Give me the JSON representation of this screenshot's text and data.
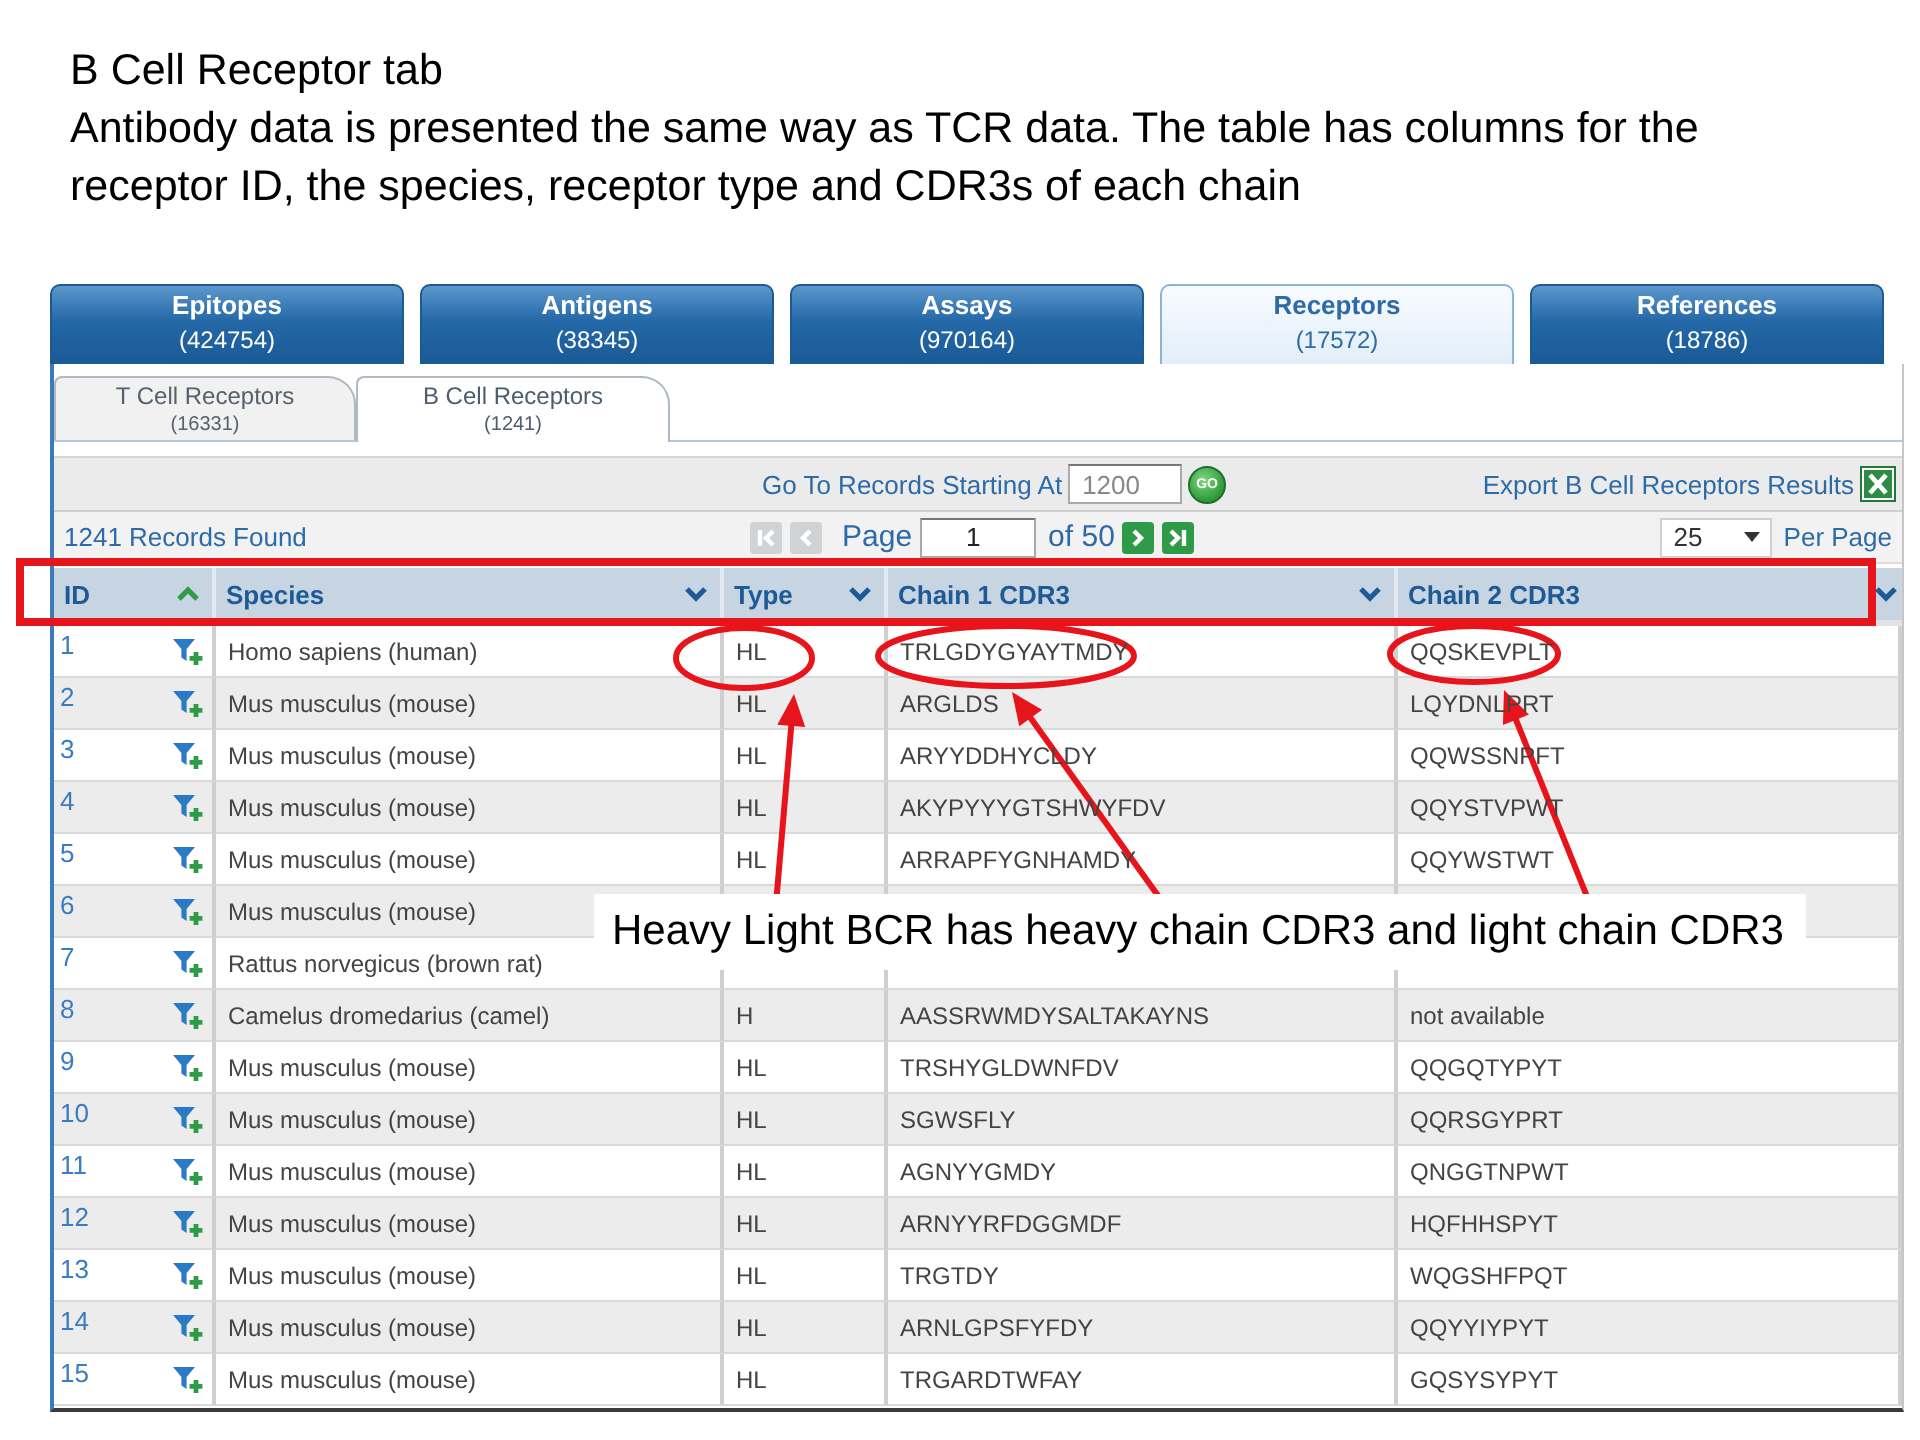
{
  "slide": {
    "title": "B Cell Receptor tab",
    "description": "Antibody data is presented the same way as TCR data. The table has columns for the receptor ID, the species, receptor type and CDR3s of each chain"
  },
  "main_tabs": [
    {
      "label": "Epitopes",
      "count": "(424754)",
      "selected": false
    },
    {
      "label": "Antigens",
      "count": "(38345)",
      "selected": false
    },
    {
      "label": "Assays",
      "count": "(970164)",
      "selected": false
    },
    {
      "label": "Receptors",
      "count": "(17572)",
      "selected": true
    },
    {
      "label": "References",
      "count": "(18786)",
      "selected": false
    }
  ],
  "sub_tabs": [
    {
      "label": "T Cell Receptors",
      "count": "(16331)",
      "selected": false
    },
    {
      "label": "B Cell Receptors",
      "count": "(1241)",
      "selected": true
    }
  ],
  "goto": {
    "label": "Go To Records Starting At",
    "value": "1200",
    "button": "GO"
  },
  "export": {
    "label": "Export B Cell Receptors Results"
  },
  "pager": {
    "records_found": "1241 Records Found",
    "back_buttons": [
      {
        "kind": "first",
        "disabled": true
      },
      {
        "kind": "previous",
        "disabled": true
      }
    ],
    "page_label": "Page",
    "page_value": "1",
    "page_total": "of 50",
    "forward_buttons": [
      {
        "kind": "next",
        "disabled": false
      },
      {
        "kind": "last",
        "disabled": false
      }
    ],
    "page_size": "25",
    "per_page_label": "Per Page"
  },
  "table": {
    "columns": [
      {
        "label": "ID",
        "sorted": true
      },
      {
        "label": "Species",
        "sorted": false
      },
      {
        "label": "Type",
        "sorted": false
      },
      {
        "label": "Chain 1 CDR3",
        "sorted": false
      },
      {
        "label": "Chain 2 CDR3",
        "sorted": false
      }
    ],
    "rows": [
      {
        "id": "1",
        "species": "Homo sapiens (human)",
        "type": "HL",
        "chain_1_cdr3": "TRLGDYGYAYTMDY",
        "chain_2_cdr3": "QQSKEVPLT"
      },
      {
        "id": "2",
        "species": "Mus musculus (mouse)",
        "type": "HL",
        "chain_1_cdr3": "ARGLDS",
        "chain_2_cdr3": "LQYDNLPRT"
      },
      {
        "id": "3",
        "species": "Mus musculus (mouse)",
        "type": "HL",
        "chain_1_cdr3": "ARYYDDHYCLDY",
        "chain_2_cdr3": "QQWSSNPFT"
      },
      {
        "id": "4",
        "species": "Mus musculus (mouse)",
        "type": "HL",
        "chain_1_cdr3": "AKYPYYYGTSHWYFDV",
        "chain_2_cdr3": "QQYSTVPWT"
      },
      {
        "id": "5",
        "species": "Mus musculus (mouse)",
        "type": "HL",
        "chain_1_cdr3": "ARRAPFYGNHAMDY",
        "chain_2_cdr3": "QQYWSTWT"
      },
      {
        "id": "6",
        "species": "Mus musculus (mouse)"
      },
      {
        "id": "7",
        "species": "Rattus norvegicus (brown rat)"
      },
      {
        "id": "8",
        "species": "Camelus dromedarius (camel)",
        "type": "H",
        "chain_1_cdr3": "AASSRWMDYSALTAKAYNS",
        "chain_2_cdr3": "not available"
      },
      {
        "id": "9",
        "species": "Mus musculus (mouse)",
        "type": "HL",
        "chain_1_cdr3": "TRSHYGLDWNFDV",
        "chain_2_cdr3": "QQGQTYPYT"
      },
      {
        "id": "10",
        "species": "Mus musculus (mouse)",
        "type": "HL",
        "chain_1_cdr3": "SGWSFLY",
        "chain_2_cdr3": "QQRSGYPRT"
      },
      {
        "id": "11",
        "species": "Mus musculus (mouse)",
        "type": "HL",
        "chain_1_cdr3": "AGNYYGMDY",
        "chain_2_cdr3": "QNGGTNPWT"
      },
      {
        "id": "12",
        "species": "Mus musculus (mouse)",
        "type": "HL",
        "chain_1_cdr3": "ARNYYRFDGGMDF",
        "chain_2_cdr3": "HQFHHSPYT"
      },
      {
        "id": "13",
        "species": "Mus musculus (mouse)",
        "type": "HL",
        "chain_1_cdr3": "TRGTDY",
        "chain_2_cdr3": "WQGSHFPQT"
      },
      {
        "id": "14",
        "species": "Mus musculus (mouse)",
        "type": "HL",
        "chain_1_cdr3": "ARNLGPSFYFDY",
        "chain_2_cdr3": "QQYYIYPYT"
      },
      {
        "id": "15",
        "species": "Mus musculus (mouse)",
        "type": "HL",
        "chain_1_cdr3": "TRGARDTWFAY",
        "chain_2_cdr3": "GQSYSYPYT"
      }
    ]
  },
  "annotation": {
    "callout": "Heavy Light BCR has heavy chain CDR3 and light chain CDR3"
  }
}
